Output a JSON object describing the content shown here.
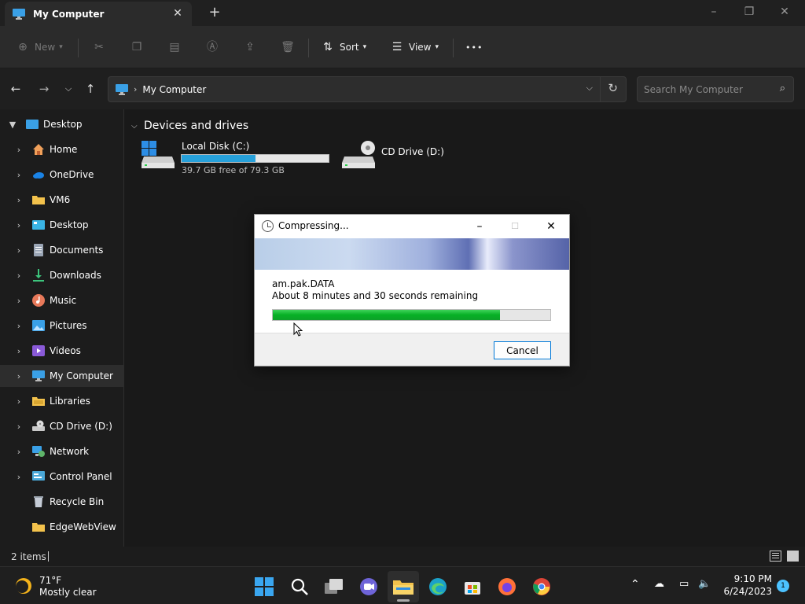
{
  "window": {
    "tab_title": "My Computer",
    "tab_close": "✕",
    "new_tab": "+"
  },
  "toolbar": {
    "new_label": "New",
    "sort_label": "Sort",
    "view_label": "View",
    "more_label": "•••"
  },
  "address": {
    "crumbs": [
      "My Computer"
    ],
    "search_placeholder": "Search My Computer"
  },
  "sidebar": {
    "items": [
      {
        "label": "Desktop",
        "icon": "desktop-icon"
      },
      {
        "label": "Home",
        "icon": "home-icon"
      },
      {
        "label": "OneDrive",
        "icon": "cloud-icon"
      },
      {
        "label": "VM6",
        "icon": "folder-icon"
      },
      {
        "label": "Desktop",
        "icon": "desktop-icon"
      },
      {
        "label": "Documents",
        "icon": "documents-icon"
      },
      {
        "label": "Downloads",
        "icon": "download-icon"
      },
      {
        "label": "Music",
        "icon": "music-icon"
      },
      {
        "label": "Pictures",
        "icon": "pictures-icon"
      },
      {
        "label": "Videos",
        "icon": "videos-icon"
      },
      {
        "label": "My Computer",
        "icon": "computer-icon"
      },
      {
        "label": "Libraries",
        "icon": "libraries-icon"
      },
      {
        "label": "CD Drive (D:)",
        "icon": "cd-drive-icon"
      },
      {
        "label": "Network",
        "icon": "network-icon"
      },
      {
        "label": "Control Panel",
        "icon": "control-panel-icon"
      },
      {
        "label": "Recycle Bin",
        "icon": "recycle-bin-icon"
      },
      {
        "label": "EdgeWebView",
        "icon": "folder-icon"
      }
    ]
  },
  "main": {
    "section_title": "Devices and drives",
    "drives": [
      {
        "name": "Local Disk (C:)",
        "free_text": "39.7 GB free of 79.3 GB",
        "used_fraction": 0.5
      },
      {
        "name": "CD Drive (D:)"
      }
    ]
  },
  "status": {
    "item_count": "2 items"
  },
  "dialog": {
    "title": "Compressing...",
    "file_name": "am.pak.DATA",
    "remaining": "About 8 minutes and 30 seconds remaining",
    "progress_fraction": 0.82,
    "cancel_label": "Cancel"
  },
  "taskbar": {
    "temperature": "71°F",
    "condition": "Mostly clear",
    "time": "9:10 PM",
    "date": "6/24/2023",
    "notification_count": "1"
  },
  "colors": {
    "accent": "#26a0da",
    "progress_green": "#06b025",
    "dark_bg": "#191919"
  }
}
